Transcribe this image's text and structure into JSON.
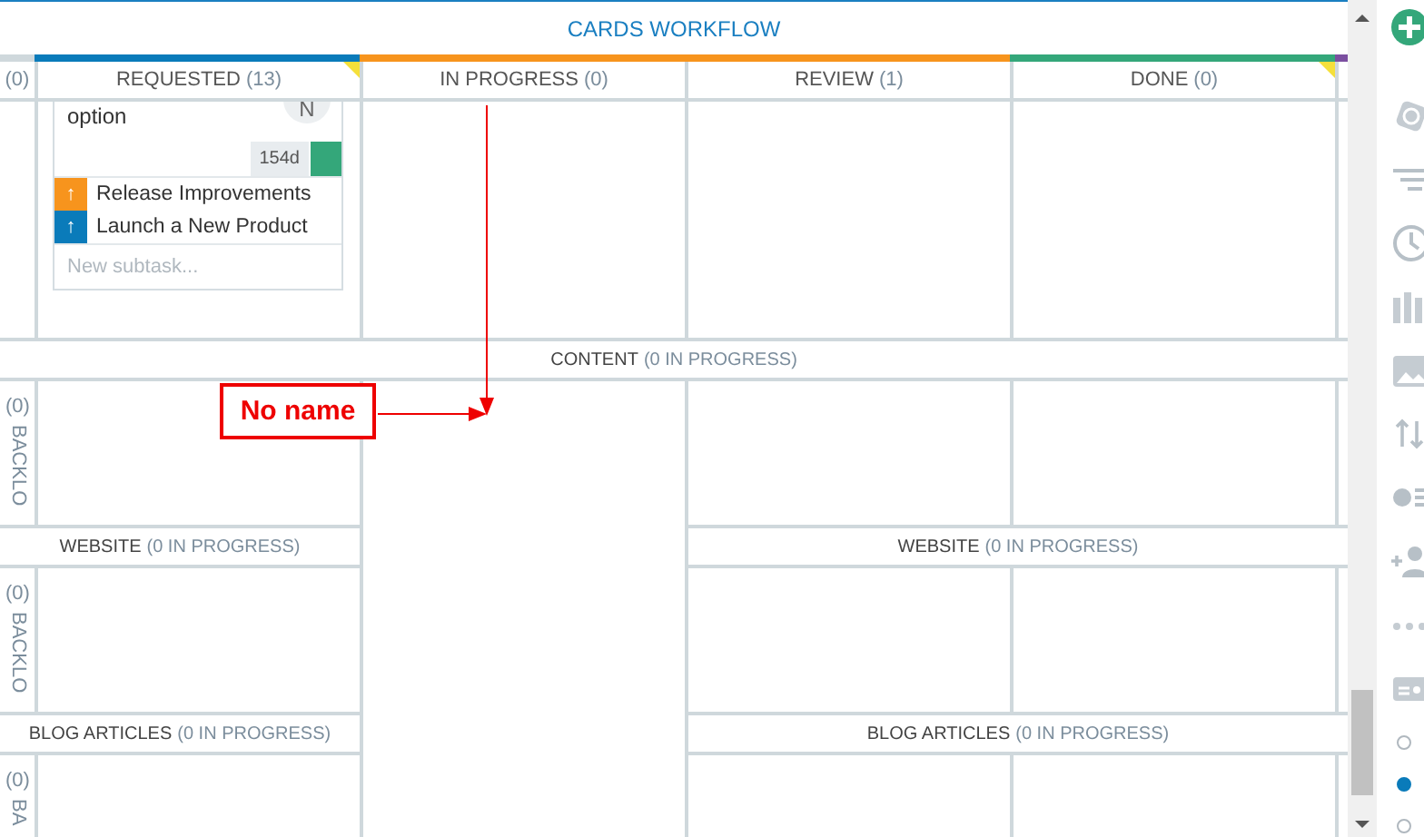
{
  "board": {
    "title": "CARDS WORKFLOW",
    "columns": [
      {
        "count": "(0)",
        "color": "#cfd8dc",
        "corner_marked": false
      },
      {
        "label": "REQUESTED",
        "count": "(13)",
        "color": "#0a7bba",
        "corner_marked": true
      },
      {
        "label": "IN PROGRESS",
        "count": "(0)",
        "color": "#f7941d",
        "corner_marked": false
      },
      {
        "label": "REVIEW",
        "count": "(1)",
        "color": "#f7941d",
        "corner_marked": false
      },
      {
        "label": "DONE",
        "count": "(0)",
        "color": "#34a77a",
        "corner_marked": true
      },
      {
        "color": "#7b4fa0",
        "corner_marked": false
      }
    ],
    "card": {
      "text": "option",
      "avatar": "N",
      "age": "154d",
      "status": {
        "color": "#34a77a"
      },
      "subtasks": [
        {
          "label": "Release Improvements",
          "color": "#f7941d",
          "glyph": "↑"
        },
        {
          "label": "Launch a New Product",
          "color": "#0a7bba",
          "glyph": "↑"
        }
      ],
      "new_subtask": {
        "placeholder": "New subtask..."
      }
    },
    "lanes": [
      {
        "headers": [
          {
            "name": "CONTENT",
            "count": "(0 IN PROGRESS)"
          }
        ],
        "side": {
          "count": "(0)",
          "label": "BACKLO"
        }
      },
      {
        "headers": [
          {
            "name": "WEBSITE",
            "count": "(0 IN PROGRESS)"
          },
          {
            "name": "WEBSITE",
            "count": "(0 IN PROGRESS)"
          }
        ],
        "side": {
          "count": "(0)",
          "label": "BACKLO"
        }
      },
      {
        "headers": [
          {
            "name": "BLOG ARTICLES",
            "count": "(0 IN PROGRESS)"
          },
          {
            "name": "BLOG ARTICLES",
            "count": "(0 IN PROGRESS)"
          }
        ],
        "side": {
          "count": "(0)",
          "label": "BA"
        }
      }
    ]
  },
  "annotation": {
    "label": "No name"
  },
  "sidebar": {
    "pages": [
      {
        "selected": false
      },
      {
        "selected": true
      },
      {
        "selected": false
      }
    ]
  }
}
